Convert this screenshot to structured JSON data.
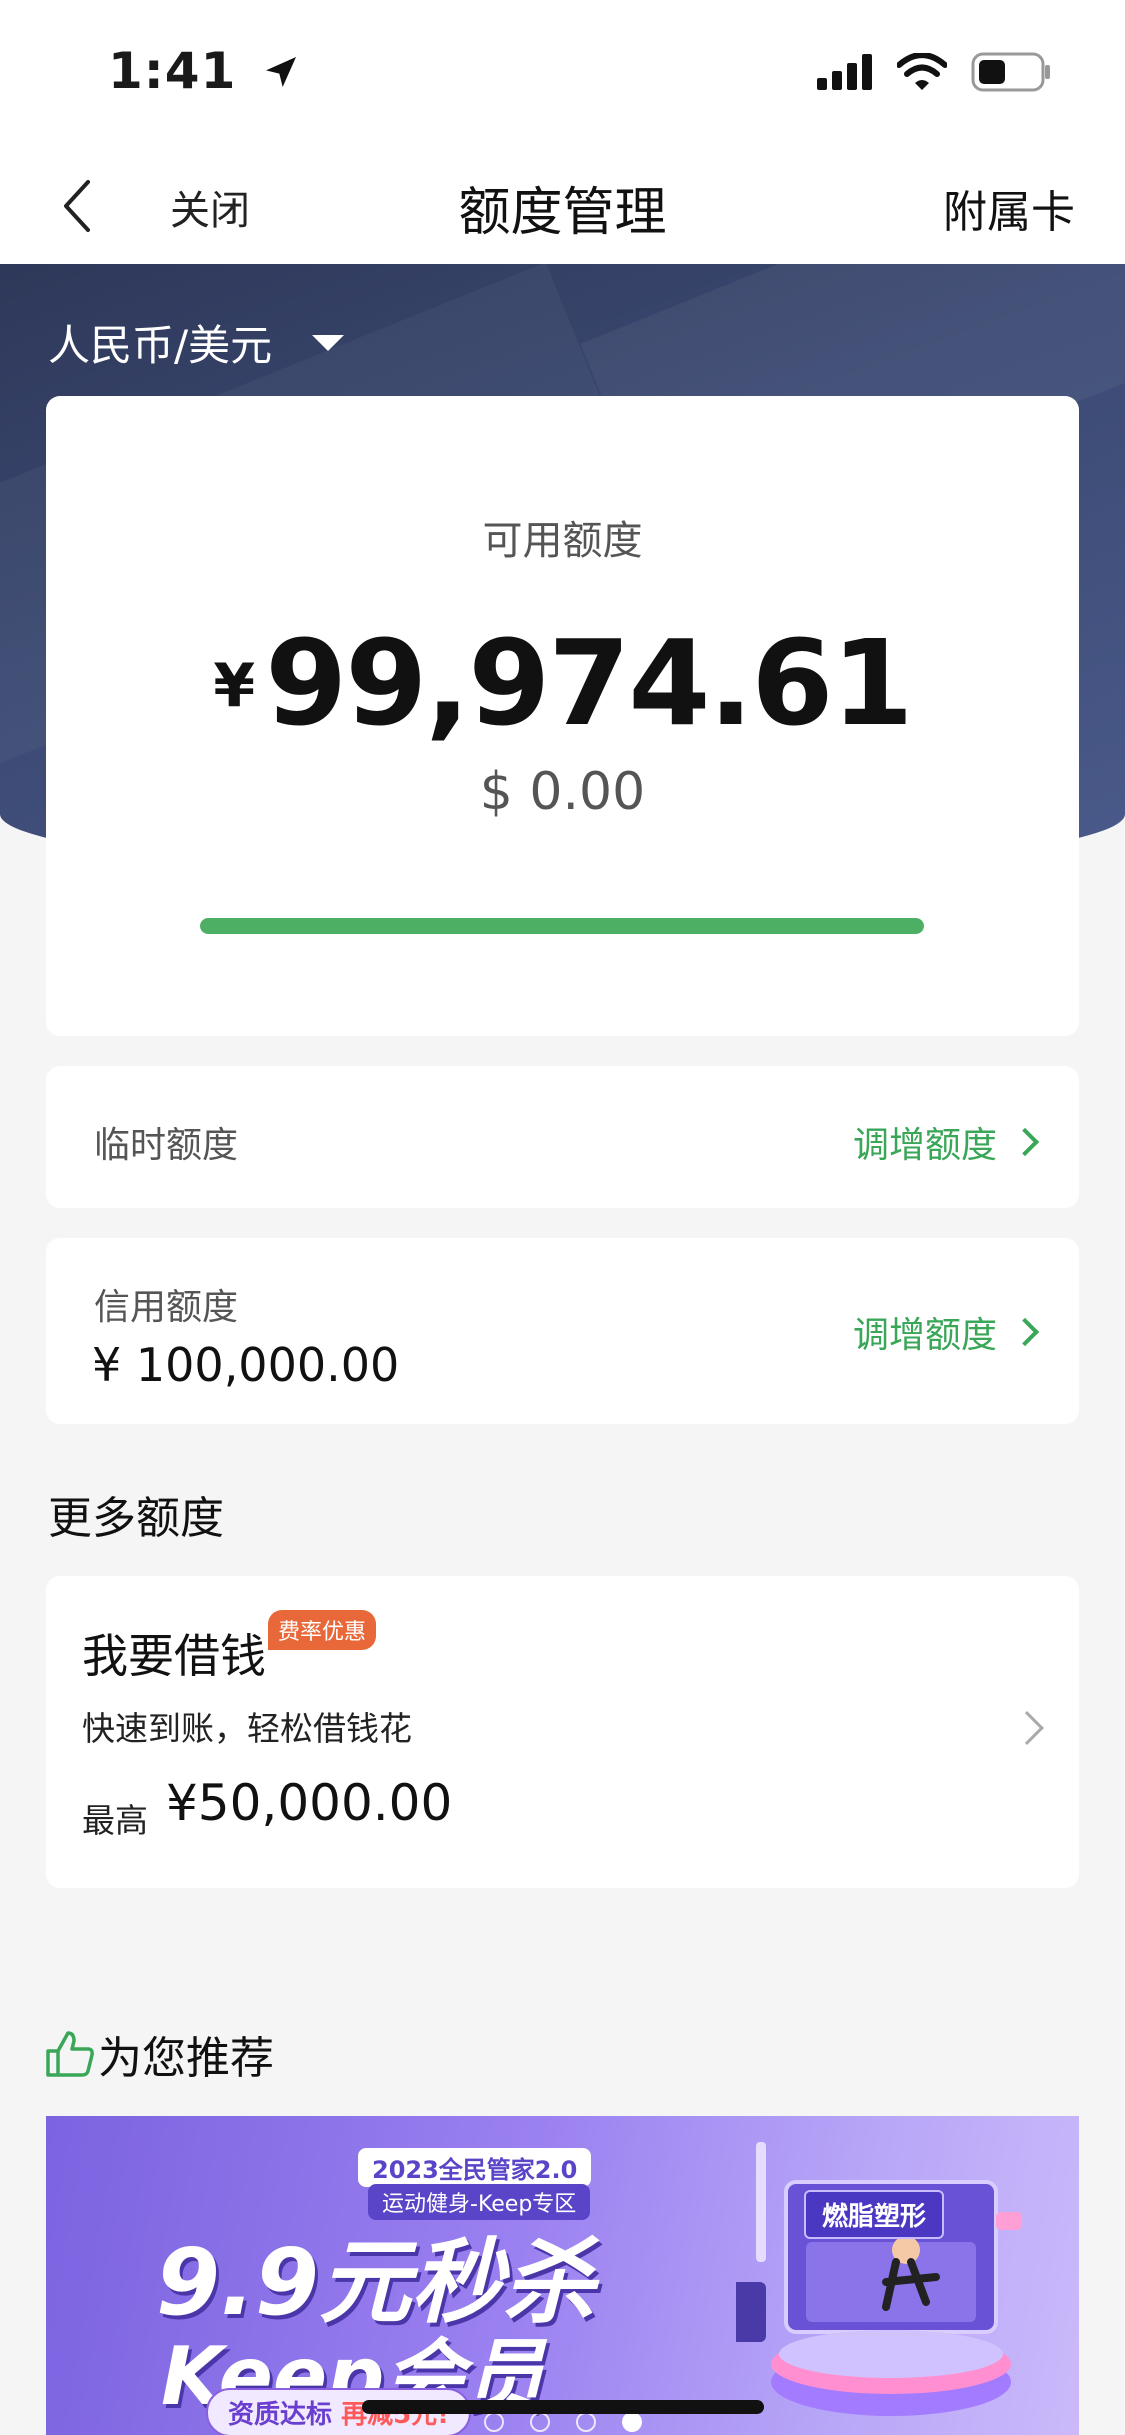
{
  "status_bar": {
    "time": "1:41"
  },
  "nav": {
    "close_label": "关闭",
    "title": "额度管理",
    "right_label": "附属卡"
  },
  "currency": {
    "selected": "人民币/美元"
  },
  "available": {
    "label": "可用额度",
    "currency_symbol": "¥",
    "amount": "99,974.61",
    "usd_amount": "$ 0.00",
    "used_fraction": 1.0
  },
  "temp_limit": {
    "label": "临时额度",
    "action": "调增额度"
  },
  "credit_limit": {
    "label": "信用额度",
    "value": "¥ 100,000.00",
    "action": "调增额度"
  },
  "more_section": {
    "title": "更多额度"
  },
  "loan": {
    "title": "我要借钱",
    "badge": "费率优惠",
    "desc": "快速到账，轻松借钱花",
    "max_label": "最高",
    "max_value": "¥50,000.00"
  },
  "recommend": {
    "title": "为您推荐"
  },
  "banner": {
    "tag1": "2023全民管家2.0",
    "tag2": "运动健身-Keep专区",
    "headline1": "9.9元秒杀",
    "headline2": "Keep会员",
    "chip_text": "资质达标 ",
    "chip_highlight": "再减5元!",
    "sign_text": "燃脂塑形",
    "dots_total": 4,
    "dots_active": 4
  },
  "colors": {
    "accent_green": "#3aa657",
    "progress_green": "#4caf63",
    "header_navy": "#3c4a74",
    "badge_orange": "#e8683a",
    "banner_purple": "#7c63e0"
  },
  "icons": {
    "location": "location-arrow-icon",
    "signal": "signal-icon",
    "wifi": "wifi-icon",
    "battery": "battery-icon",
    "back": "chevron-left-icon",
    "dropdown": "triangle-down-icon",
    "chevron": "chevron-right-icon",
    "thumbs_up": "thumbs-up-icon"
  }
}
